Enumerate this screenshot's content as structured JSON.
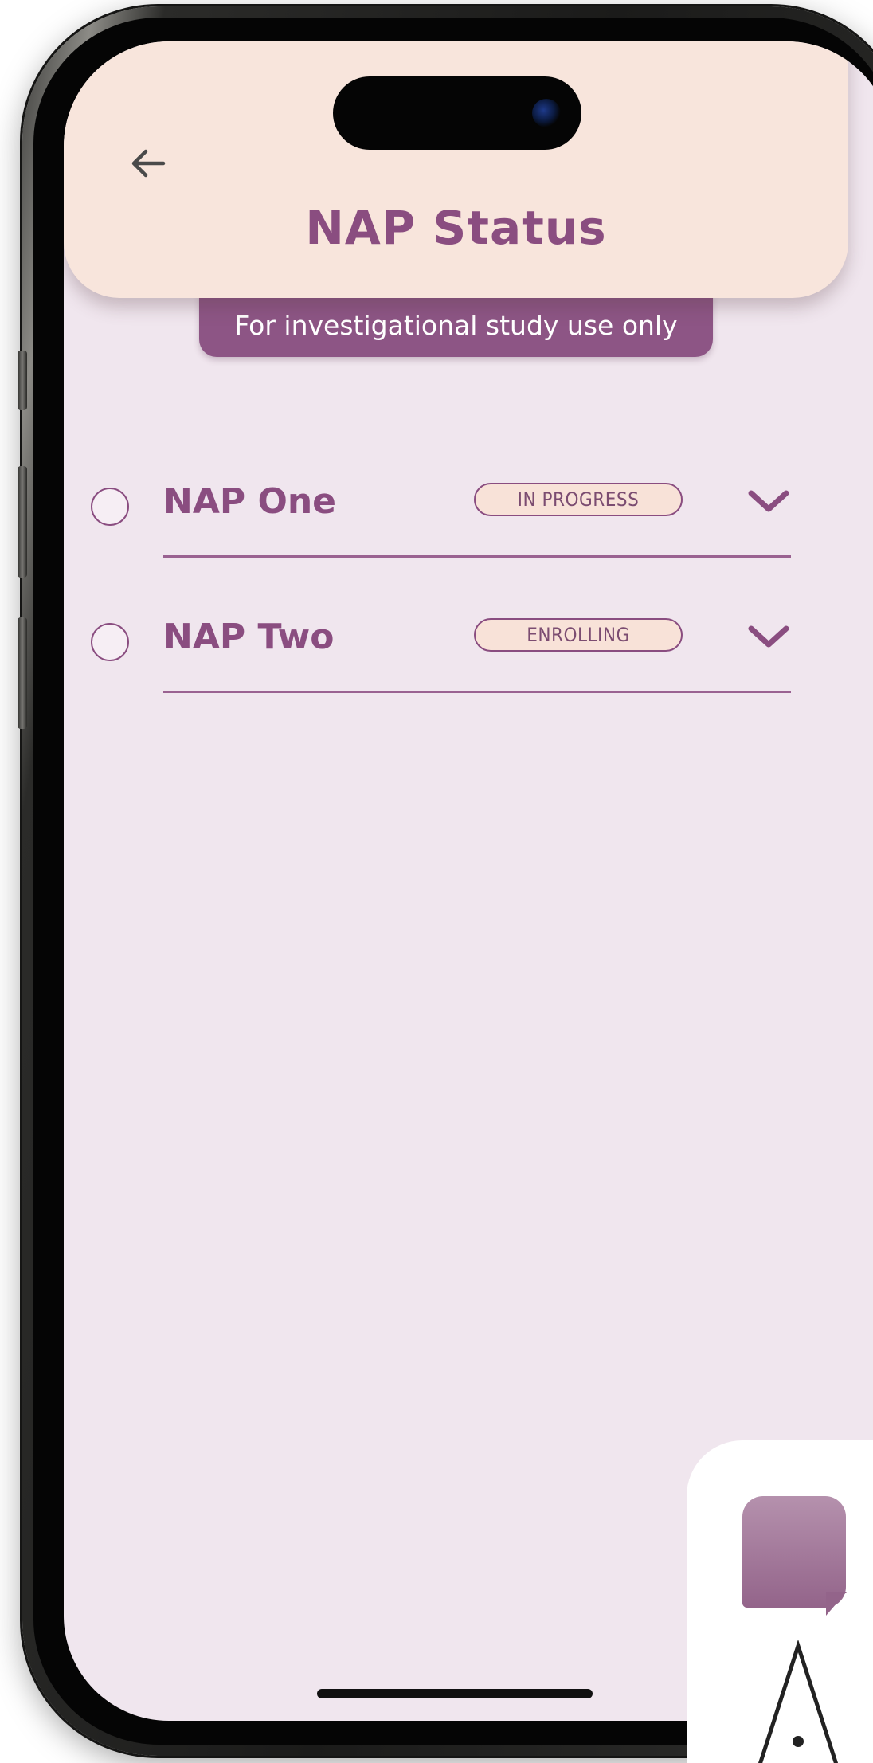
{
  "header": {
    "back_icon": "arrow-left-icon",
    "title": "NAP Status"
  },
  "disclaimer": {
    "text": "For investigational study use only"
  },
  "naps": [
    {
      "name": "NAP One",
      "status": "IN PROGRESS",
      "selected": false
    },
    {
      "name": "NAP Two",
      "status": "ENROLLING",
      "selected": false
    }
  ],
  "colors": {
    "accent": "#8a4d80",
    "header_bg": "#f8e5dc",
    "screen_bg": "#f0e6ee",
    "badge_bg": "#f8e2d8"
  },
  "logo": {
    "text": "AI"
  }
}
